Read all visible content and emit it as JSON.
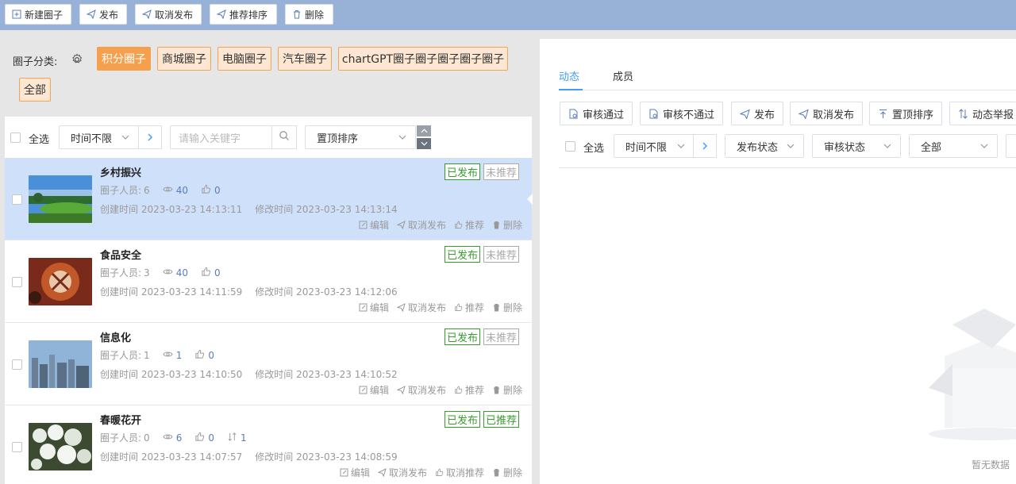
{
  "toolbar": {
    "new_label": "新建圈子",
    "publish_label": "发布",
    "unpublish_label": "取消发布",
    "recommend_sort_label": "推荐排序",
    "delete_label": "删除"
  },
  "category": {
    "label": "圈子分类:",
    "tags": [
      "积分圈子",
      "商城圈子",
      "电脑圈子",
      "汽车圈子",
      "chartGPT圈子圈子圈子圈子圈子",
      "全部"
    ],
    "active_tag": "积分圈子"
  },
  "list_filter": {
    "select_all": "全选",
    "time_select": "时间不限",
    "search_placeholder": "请输入关键字",
    "sort_select": "置顶排序"
  },
  "items": [
    {
      "title": "乡村振兴",
      "members_label": "圈子人员:",
      "members": "6",
      "views": "40",
      "likes": "0",
      "created_label": "创建时间",
      "created": "2023-03-23 14:13:11",
      "modified_label": "修改时间",
      "modified": "2023-03-23 14:13:14",
      "status": "已发布",
      "recommend": "未推荐",
      "actions": [
        "编辑",
        "取消发布",
        "推荐",
        "删除"
      ]
    },
    {
      "title": "食品安全",
      "members_label": "圈子人员:",
      "members": "3",
      "views": "40",
      "likes": "0",
      "created_label": "创建时间",
      "created": "2023-03-23 14:11:59",
      "modified_label": "修改时间",
      "modified": "2023-03-23 14:12:06",
      "status": "已发布",
      "recommend": "未推荐",
      "actions": [
        "编辑",
        "取消发布",
        "推荐",
        "删除"
      ]
    },
    {
      "title": "信息化",
      "members_label": "圈子人员:",
      "members": "1",
      "views": "1",
      "likes": "0",
      "created_label": "创建时间",
      "created": "2023-03-23 14:10:50",
      "modified_label": "修改时间",
      "modified": "2023-03-23 14:10:52",
      "status": "已发布",
      "recommend": "未推荐",
      "actions": [
        "编辑",
        "取消发布",
        "推荐",
        "删除"
      ]
    },
    {
      "title": "春暖花开",
      "members_label": "圈子人员:",
      "members": "0",
      "views": "6",
      "likes": "0",
      "sort": "1",
      "created_label": "创建时间",
      "created": "2023-03-23 14:07:57",
      "modified_label": "修改时间",
      "modified": "2023-03-23 14:08:59",
      "status": "已发布",
      "recommend": "已推荐",
      "actions": [
        "编辑",
        "取消发布",
        "取消推荐",
        "删除"
      ]
    }
  ],
  "right": {
    "tabs": [
      "动态",
      "成员"
    ],
    "buttons": [
      "审核通过",
      "审核不通过",
      "发布",
      "取消发布",
      "置顶排序",
      "动态举报"
    ],
    "select_all": "全选",
    "time_select": "时间不限",
    "publish_status": "发布状态",
    "audit_status": "审核状态",
    "all_select": "全部",
    "empty_text": "暂无数据"
  },
  "colors": {
    "topbar": "#98b1d7",
    "accent": "#409eff",
    "tag_active": "#f6a04d",
    "published": "#3a9a2e"
  }
}
